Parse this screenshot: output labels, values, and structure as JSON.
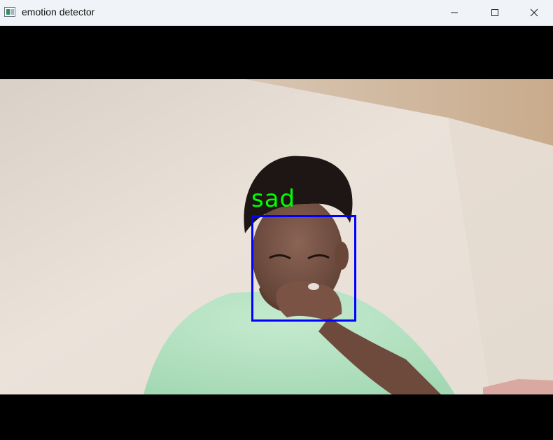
{
  "window": {
    "title": "emotion detector",
    "controls": {
      "minimize_icon": "minimize-icon",
      "maximize_icon": "maximize-icon",
      "close_icon": "close-icon"
    }
  },
  "detection": {
    "label": "sad",
    "box_color": "#0000ff",
    "label_color": "#00ff00"
  }
}
